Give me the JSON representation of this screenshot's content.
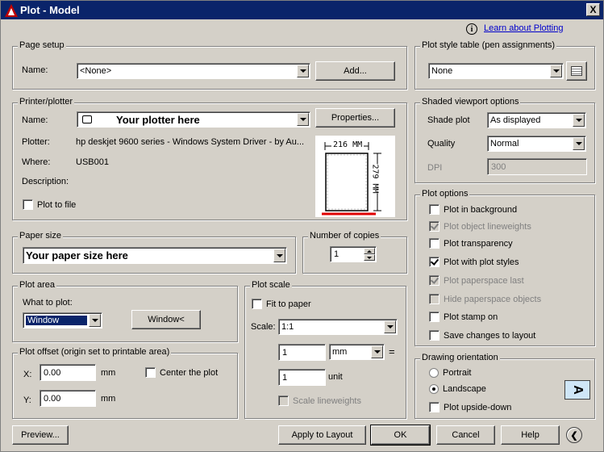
{
  "window": {
    "title": "Plot - Model",
    "close": "X"
  },
  "header": {
    "learn_link": "Learn about Plotting",
    "info_glyph": "i"
  },
  "page_setup": {
    "legend": "Page setup",
    "name_label": "Name:",
    "name_value": "<None>",
    "add_button": "Add..."
  },
  "printer": {
    "legend": "Printer/plotter",
    "name_label": "Name:",
    "name_value": "Your plotter here",
    "properties_button": "Properties...",
    "plotter_label": "Plotter:",
    "plotter_value": "hp deskjet 9600 series - Windows System Driver - by Au...",
    "where_label": "Where:",
    "where_value": "USB001",
    "description_label": "Description:",
    "plot_to_file": "Plot to file",
    "preview_width": "216 MM",
    "preview_height": "279 MM"
  },
  "paper_size": {
    "legend": "Paper size",
    "value": "Your paper size here"
  },
  "copies": {
    "legend": "Number of copies",
    "value": "1"
  },
  "plot_area": {
    "legend": "Plot area",
    "what_label": "What to plot:",
    "value": "Window",
    "window_button": "Window<"
  },
  "plot_offset": {
    "legend": "Plot offset (origin set to printable area)",
    "x_label": "X:",
    "x_value": "0.00",
    "x_unit": "mm",
    "y_label": "Y:",
    "y_value": "0.00",
    "y_unit": "mm",
    "center": "Center the plot"
  },
  "plot_scale": {
    "legend": "Plot scale",
    "fit": "Fit to paper",
    "scale_label": "Scale:",
    "scale_value": "1:1",
    "value1": "1",
    "unit_value": "mm",
    "equals": "=",
    "value2": "1",
    "unit_label": "unit",
    "scale_lineweights": "Scale lineweights"
  },
  "plot_style": {
    "legend": "Plot style table (pen assignments)",
    "value": "None"
  },
  "shaded": {
    "legend": "Shaded viewport options",
    "shade_label": "Shade plot",
    "shade_value": "As displayed",
    "quality_label": "Quality",
    "quality_value": "Normal",
    "dpi_label": "DPI",
    "dpi_value": "300"
  },
  "plot_options": {
    "legend": "Plot options",
    "items": [
      {
        "label": "Plot in background",
        "checked": false,
        "enabled": true
      },
      {
        "label": "Plot object lineweights",
        "checked": true,
        "enabled": false
      },
      {
        "label": "Plot transparency",
        "checked": false,
        "enabled": true
      },
      {
        "label": "Plot with plot styles",
        "checked": true,
        "enabled": true
      },
      {
        "label": "Plot paperspace last",
        "checked": true,
        "enabled": false
      },
      {
        "label": "Hide paperspace objects",
        "checked": false,
        "enabled": false
      },
      {
        "label": "Plot stamp on",
        "checked": false,
        "enabled": true
      },
      {
        "label": "Save changes to layout",
        "checked": false,
        "enabled": true
      }
    ]
  },
  "orientation": {
    "legend": "Drawing orientation",
    "portrait": "Portrait",
    "landscape": "Landscape",
    "upside": "Plot upside-down",
    "icon_glyph": "A"
  },
  "footer": {
    "preview": "Preview...",
    "apply": "Apply to Layout",
    "ok": "OK",
    "cancel": "Cancel",
    "help": "Help",
    "more_glyph": "❮"
  }
}
